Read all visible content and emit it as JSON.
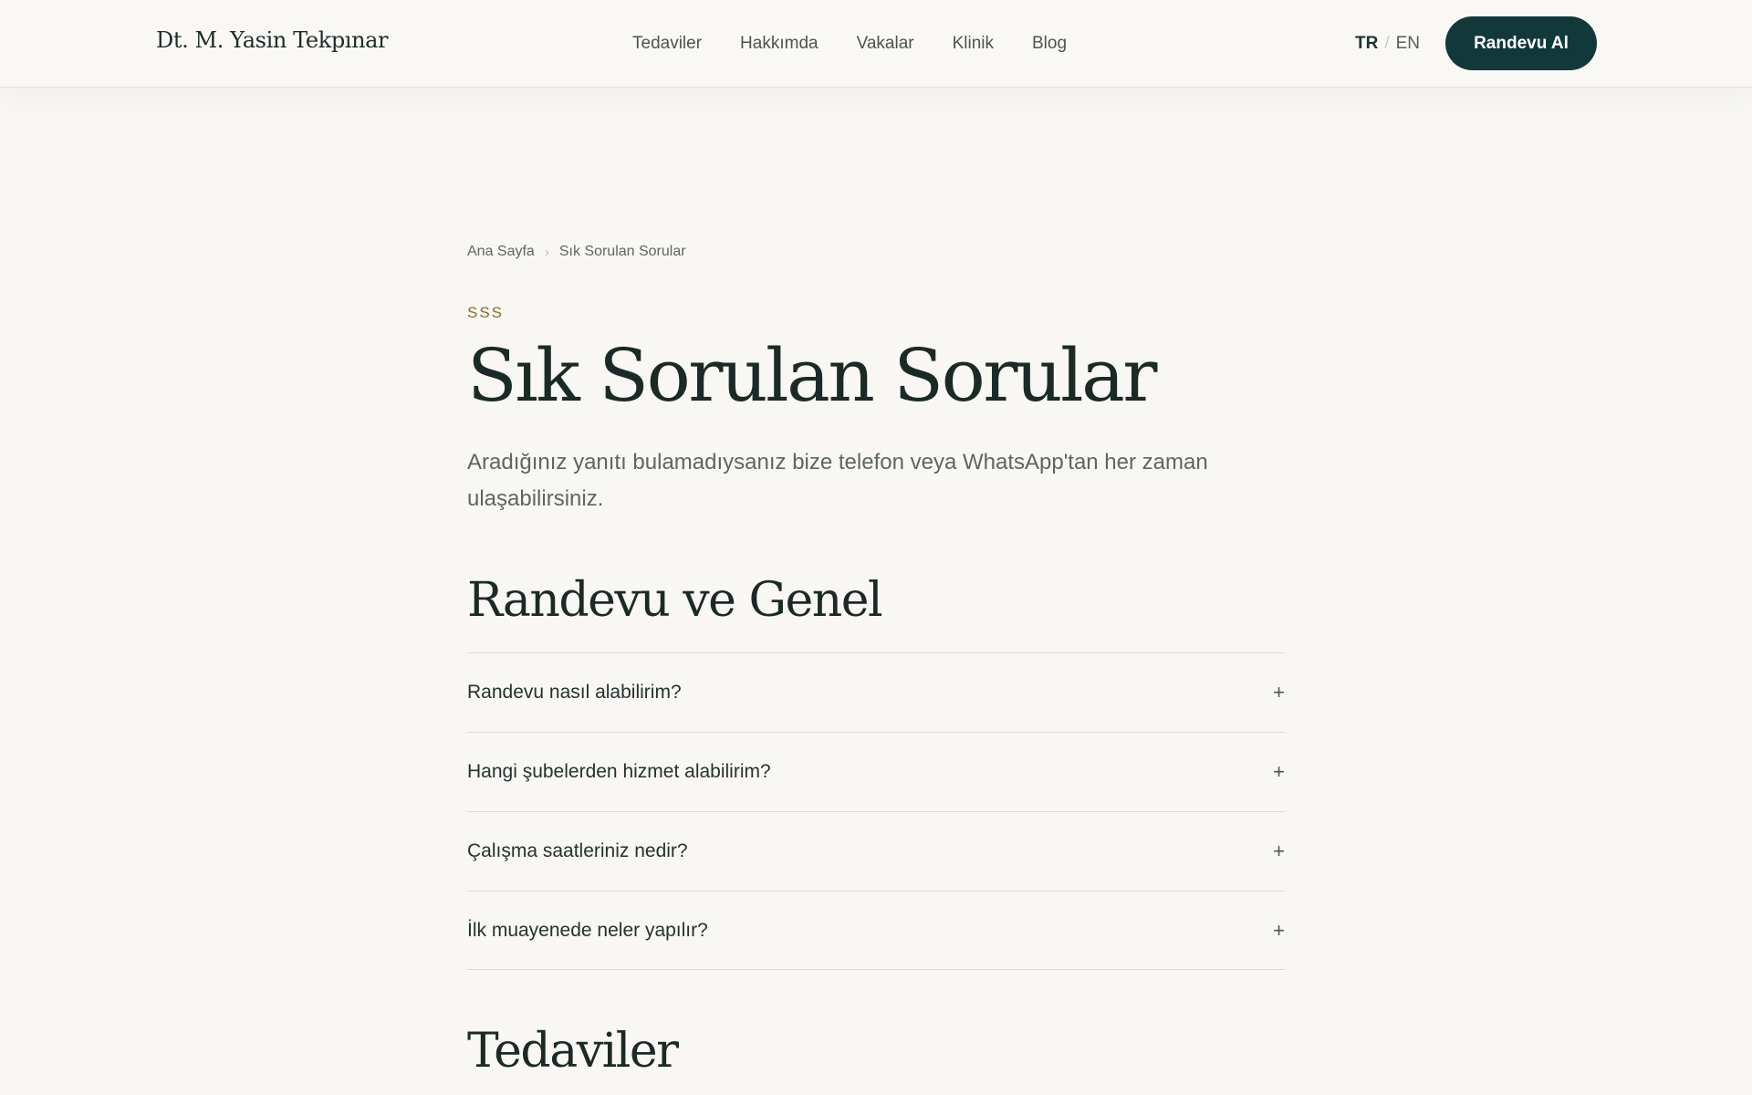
{
  "header": {
    "logo": "Dt. M. Yasin Tekpınar",
    "nav": [
      "Tedaviler",
      "Hakkımda",
      "Vakalar",
      "Klinik",
      "Blog"
    ],
    "lang_active": "TR",
    "lang_separator": "/",
    "lang_other": "EN",
    "cta_label": "Randevu Al"
  },
  "breadcrumb": {
    "home": "Ana Sayfa",
    "separator": "›",
    "current": "Sık Sorulan Sorular"
  },
  "eyebrow": "SSS",
  "title": "Sık Sorulan Sorular",
  "lead": "Aradığınız yanıtı bulamadıysanız bize telefon veya WhatsApp'tan her zaman ulaşabilirsiniz.",
  "sections": [
    {
      "title": "Randevu ve Genel",
      "questions": [
        "Randevu nasıl alabilirim?",
        "Hangi şubelerden hizmet alabilirim?",
        "Çalışma saatleriniz nedir?",
        "İlk muayenede neler yapılır?"
      ]
    },
    {
      "title": "Tedaviler",
      "questions": []
    }
  ],
  "expand_icon": "+",
  "colors": {
    "background": "#f8f7f3",
    "accent": "#12383a",
    "eyebrow": "#8b6a2b",
    "text": "#1c2a27"
  }
}
